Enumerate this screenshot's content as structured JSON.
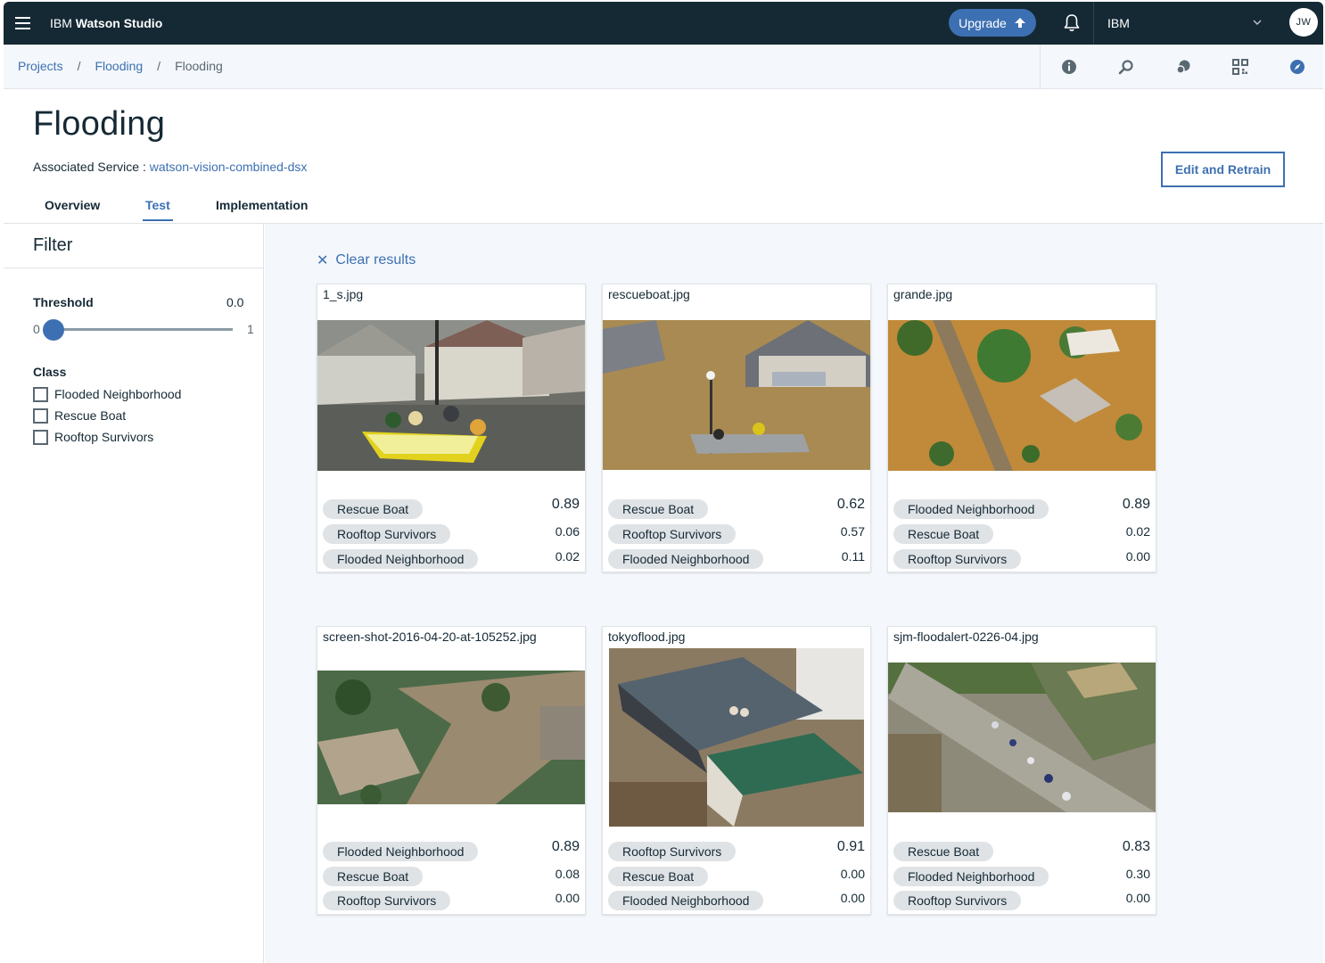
{
  "topbar": {
    "brand_prefix": "IBM",
    "brand_name": "Watson Studio",
    "upgrade_label": "Upgrade",
    "account_label": "IBM",
    "avatar_initials": "JW"
  },
  "breadcrumb": {
    "items": [
      "Projects",
      "Flooding",
      "Flooding"
    ],
    "separator": "/"
  },
  "page": {
    "title": "Flooding",
    "associated_label": "Associated Service :",
    "associated_link": "watson-vision-combined-dsx",
    "edit_button": "Edit and Retrain"
  },
  "tabs": [
    {
      "label": "Overview",
      "active": false
    },
    {
      "label": "Test",
      "active": true
    },
    {
      "label": "Implementation",
      "active": false
    }
  ],
  "filter": {
    "title": "Filter",
    "threshold_label": "Threshold",
    "threshold_value": "0.0",
    "slider_min": "0",
    "slider_max": "1",
    "class_label": "Class",
    "classes": [
      "Flooded Neighborhood",
      "Rescue Boat",
      "Rooftop Survivors"
    ]
  },
  "results": {
    "clear_label": "Clear results",
    "cards": [
      {
        "name": "1_s.jpg",
        "preds": [
          {
            "label": "Rescue Boat",
            "score": "0.89"
          },
          {
            "label": "Rooftop Survivors",
            "score": "0.06"
          },
          {
            "label": "Flooded Neighborhood",
            "score": "0.02"
          }
        ]
      },
      {
        "name": "rescueboat.jpg",
        "preds": [
          {
            "label": "Rescue Boat",
            "score": "0.62"
          },
          {
            "label": "Rooftop Survivors",
            "score": "0.57"
          },
          {
            "label": "Flooded Neighborhood",
            "score": "0.11"
          }
        ]
      },
      {
        "name": "grande.jpg",
        "preds": [
          {
            "label": "Flooded Neighborhood",
            "score": "0.89"
          },
          {
            "label": "Rescue Boat",
            "score": "0.02"
          },
          {
            "label": "Rooftop Survivors",
            "score": "0.00"
          }
        ]
      },
      {
        "name": "screen-shot-2016-04-20-at-105252.jpg",
        "preds": [
          {
            "label": "Flooded Neighborhood",
            "score": "0.89"
          },
          {
            "label": "Rescue Boat",
            "score": "0.08"
          },
          {
            "label": "Rooftop Survivors",
            "score": "0.00"
          }
        ]
      },
      {
        "name": "tokyoflood.jpg",
        "preds": [
          {
            "label": "Rooftop Survivors",
            "score": "0.91"
          },
          {
            "label": "Rescue Boat",
            "score": "0.00"
          },
          {
            "label": "Flooded Neighborhood",
            "score": "0.00"
          }
        ]
      },
      {
        "name": "sjm-floodalert-0226-04.jpg",
        "preds": [
          {
            "label": "Rescue Boat",
            "score": "0.83"
          },
          {
            "label": "Flooded Neighborhood",
            "score": "0.30"
          },
          {
            "label": "Rooftop Survivors",
            "score": "0.00"
          }
        ]
      }
    ]
  },
  "colors": {
    "topbar": "#152935",
    "accent": "#3d70b2",
    "pill": "#dfe3e6",
    "results_bg": "#f4f7fb"
  },
  "icons": [
    "hamburger-icon",
    "upload-arrow-icon",
    "bell-icon",
    "chevron-down-icon",
    "info-icon",
    "search-icon",
    "chat-icon",
    "grid-icon",
    "compass-icon",
    "close-icon"
  ]
}
